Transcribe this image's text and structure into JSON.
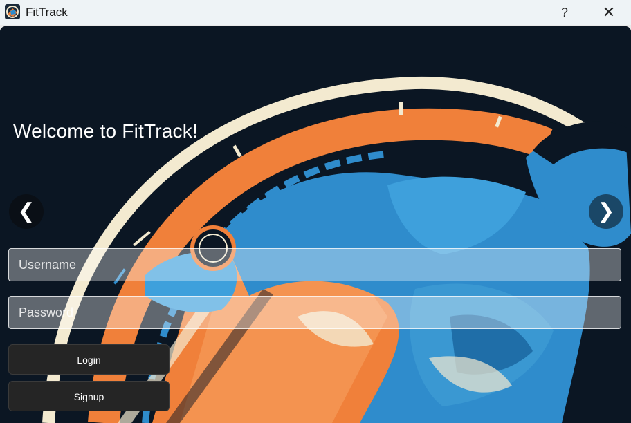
{
  "window": {
    "title": "FitTrack",
    "help_label": "?",
    "close_label": "✕"
  },
  "main": {
    "welcome_text": "Welcome to FitTrack!",
    "prev_label": "❮",
    "next_label": "❯",
    "username": {
      "placeholder": "Username",
      "value": ""
    },
    "password": {
      "placeholder": "Password",
      "value": ""
    },
    "login_label": "Login",
    "signup_label": "Signup"
  },
  "colors": {
    "accent_orange": "#f0803a",
    "accent_blue": "#2f8ccc",
    "background_navy": "#0b1623",
    "cream": "#f3ead0",
    "button_dark": "#252525"
  }
}
